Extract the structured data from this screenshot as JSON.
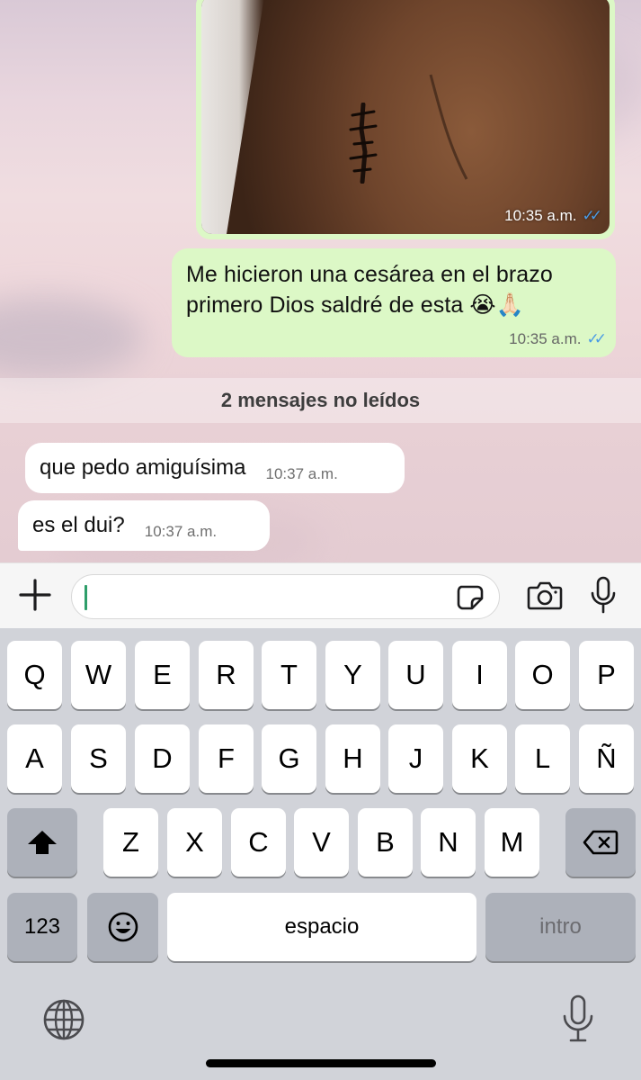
{
  "chat": {
    "photo_message": {
      "time": "10:35 a.m."
    },
    "outgoing_message": {
      "line1": "Me hicieron una cesárea en el brazo",
      "line2": "primero Dios saldré de esta 😭🙏🏻",
      "time": "10:35 a.m."
    },
    "unread_banner": "2 mensajes no leídos",
    "incoming_messages": [
      {
        "text": "que pedo amiguísima",
        "time": "10:37 a.m."
      },
      {
        "text": "es el dui?",
        "time": "10:37 a.m."
      }
    ],
    "read_receipt_color": "#4a9be5",
    "outgoing_bubble_color": "#dcf8c6"
  },
  "composer": {
    "value": "",
    "icons": [
      "plus-icon",
      "sticker-icon",
      "camera-icon",
      "microphone-icon"
    ]
  },
  "keyboard": {
    "row1": [
      "Q",
      "W",
      "E",
      "R",
      "T",
      "Y",
      "U",
      "I",
      "O",
      "P"
    ],
    "row2": [
      "A",
      "S",
      "D",
      "F",
      "G",
      "H",
      "J",
      "K",
      "L",
      "Ñ"
    ],
    "row3": [
      "Z",
      "X",
      "C",
      "V",
      "B",
      "N",
      "M"
    ],
    "numbers_label": "123",
    "space_label": "espacio",
    "return_label": "intro",
    "icons": [
      "shift-icon",
      "backspace-icon",
      "emoji-icon",
      "globe-icon",
      "dictation-mic-icon"
    ]
  }
}
